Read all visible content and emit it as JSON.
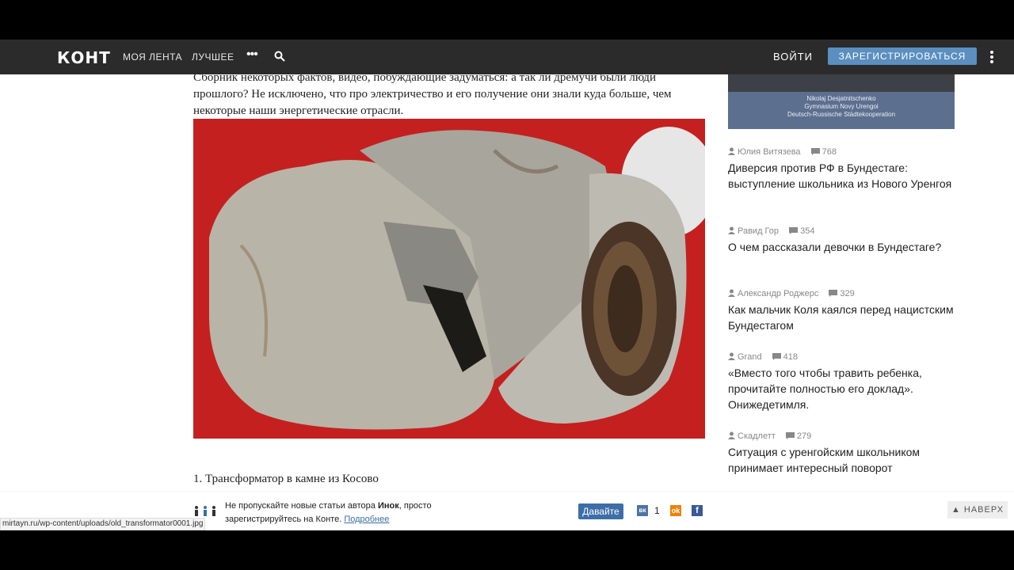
{
  "nav": {
    "logo": "КОНТ",
    "links": [
      "МОЯ ЛЕНТА",
      "ЛУЧШЕЕ"
    ],
    "more_icon": "more-dots-icon",
    "search_icon": "search-icon",
    "login": "ВОЙТИ",
    "register": "ЗАРЕГИСТРИРОВАТЬСЯ",
    "menu_icon": "kebab-icon"
  },
  "article": {
    "intro": "Сборник некоторых фактов, видео, побуждающие задуматься: а так ли дремучи были люди прошлого? Не исключено, что про электричество и его получение они знали куда больше, чем некоторые наши энергетические отрасли.",
    "heading1": "1. Трансформатор в камне из Косово"
  },
  "sidebar": {
    "video_caption": [
      "Nikolaj Desjatnitschenko",
      "Gymnasium Novy Urengoi",
      "Deutsch-Russische Städtekooperation"
    ],
    "items": [
      {
        "author": "Юлия Витязева",
        "comments": "768",
        "title": "Диверсия против РФ в Бундестаге: выступление школьника из Нового Уренгоя"
      },
      {
        "author": "Равид Гор",
        "comments": "354",
        "title": "О чем рассказали девочки в Бундестаге?"
      },
      {
        "author": "Александр Роджерс",
        "comments": "329",
        "title": "Как мальчик Коля каялся перед нацистским Бундестагом"
      },
      {
        "author": "Grand",
        "comments": "418",
        "title": "«Вместо того чтобы травить ребенка, прочитайте полностью его доклад». Онижедетимля."
      },
      {
        "author": "Скадлетт",
        "comments": "279",
        "title": "Ситуация с уренгойским школьником принимает интересный поворот"
      }
    ]
  },
  "bottom": {
    "text_before": "Не пропускайте новые статьи автора ",
    "author": "Инок",
    "text_after": ", просто зарегистрируйтесь на Конте. ",
    "more_link": "Подробнее",
    "button": "Давайте",
    "vk_count": "1",
    "up": "НАВЕРХ"
  },
  "status_url": "mirtayn.ru/wp-content/uploads/old_transformator0001.jpg"
}
